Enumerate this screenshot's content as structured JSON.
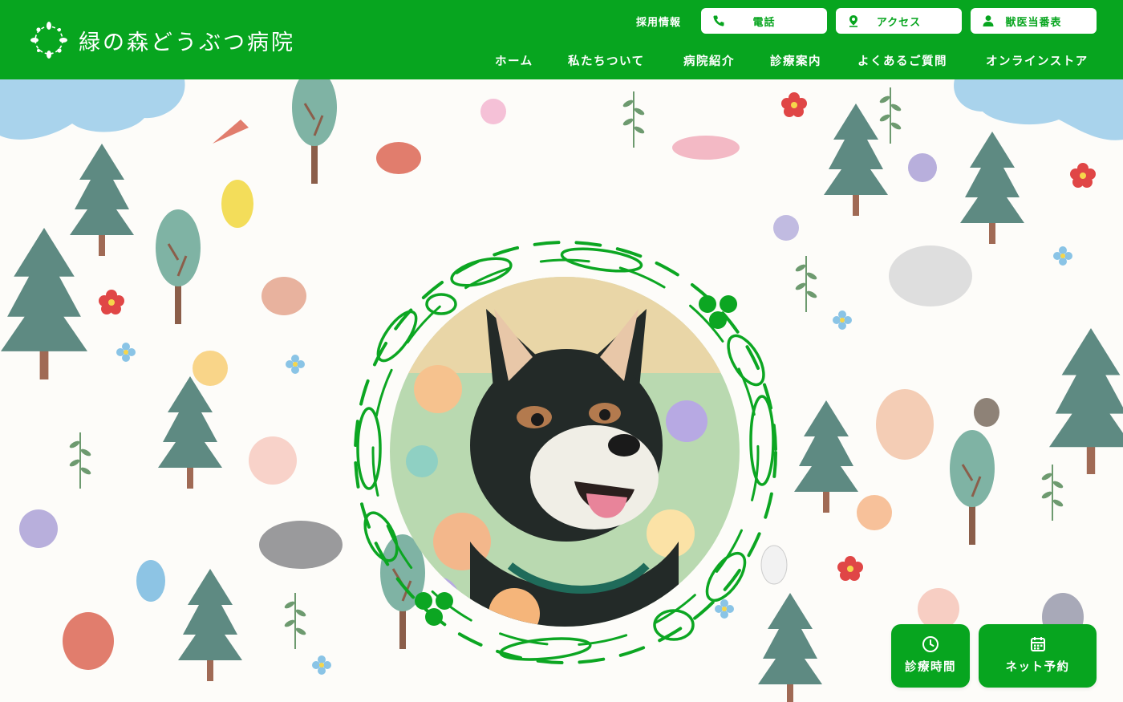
{
  "brand": {
    "name": "緑の森どうぶつ病院",
    "color": "#07a51f",
    "logo_icon": "wreath-logo-icon"
  },
  "header": {
    "utility_label": "採用情報",
    "utility_buttons": [
      {
        "label": "電話",
        "icon": "phone-icon"
      },
      {
        "label": "アクセス",
        "icon": "map-pin-icon"
      },
      {
        "label": "獣医当番表",
        "icon": "user-icon"
      }
    ],
    "nav": [
      "ホーム",
      "私たちついて",
      "病院紹介",
      "診療案内",
      "よくあるご質問",
      "オンラインストア"
    ]
  },
  "hero": {
    "image": "shiba-inu-photo",
    "frame": "leaf-wreath"
  },
  "floating": [
    {
      "label": "診療時間",
      "icon": "clock-icon"
    },
    {
      "label": "ネット予約",
      "icon": "calendar-icon"
    }
  ]
}
